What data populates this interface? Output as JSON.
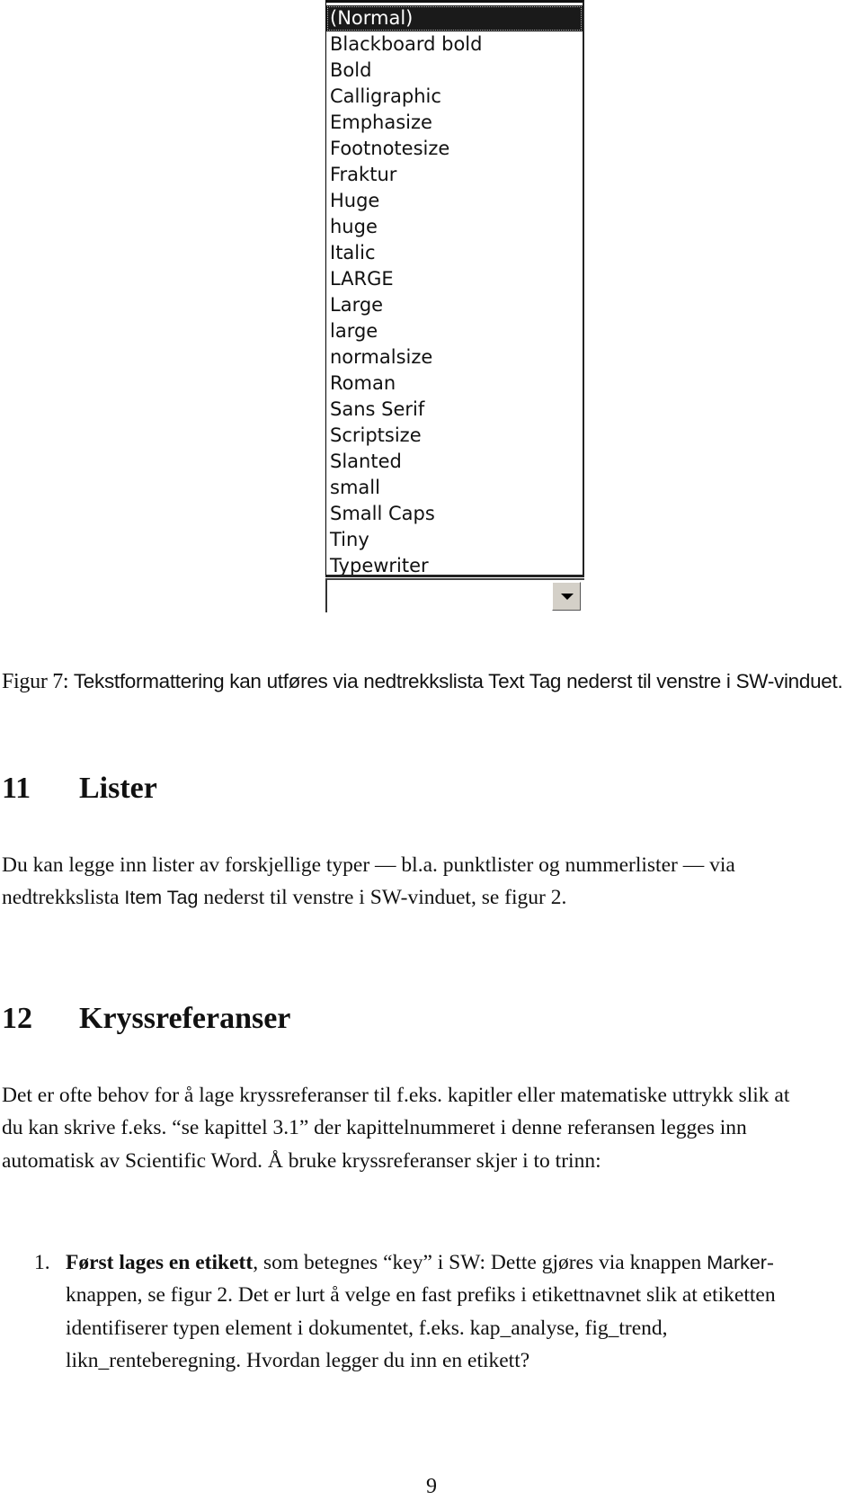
{
  "figure": {
    "listbox": {
      "selected_index": 0,
      "items": [
        "(Normal)",
        "Blackboard bold",
        "Bold",
        "Calligraphic",
        "Emphasize",
        "Footnotesize",
        "Fraktur",
        "Huge",
        "huge",
        "Italic",
        "LARGE",
        "Large",
        "large",
        "normalsize",
        "Roman",
        "Sans Serif",
        "Scriptsize",
        "Slanted",
        "small",
        "Small Caps",
        "Tiny",
        "Typewriter"
      ]
    },
    "combobox": {
      "value": "",
      "button_icon": "chevron-down-icon"
    },
    "caption": {
      "label": "Figur 7:",
      "text": "Tekstformattering kan utføres via nedtrekkslista Text Tag nederst til venstre i SW-vinduet."
    }
  },
  "section11": {
    "number": "11",
    "title": "Lister",
    "para": {
      "part1": "Du kan legge inn lister av forskjellige typer — bl.a. punktlister og nummerlister — via nedtrekkslista ",
      "ui_term": "Item Tag",
      "part2": " nederst til venstre i SW-vinduet, se figur 2."
    }
  },
  "section12": {
    "number": "12",
    "title": "Kryssreferanser",
    "para": "Det er ofte behov for å lage kryssreferanser til f.eks. kapitler eller matematiske uttrykk slik at du kan skrive f.eks. “se kapittel 3.1” der kapittelnummeret i denne referansen legges inn automatisk av Scientific Word. Å bruke kryssreferanser skjer i to trinn:",
    "steps": [
      {
        "marker": "1.",
        "bold": "Først lages en etikett",
        "part1": ", som betegnes “key” i SW: Dette gjøres via knappen ",
        "ui_term": "Marker",
        "part2": "-knappen, se figur 2. Det er lurt å velge en fast prefiks i etikettnavnet slik at etiketten identifiserer typen element i dokumentet, f.eks. kap_analyse, fig_trend, likn_renteberegning. Hvordan legger du inn en etikett?"
      }
    ]
  },
  "page_number": "9"
}
